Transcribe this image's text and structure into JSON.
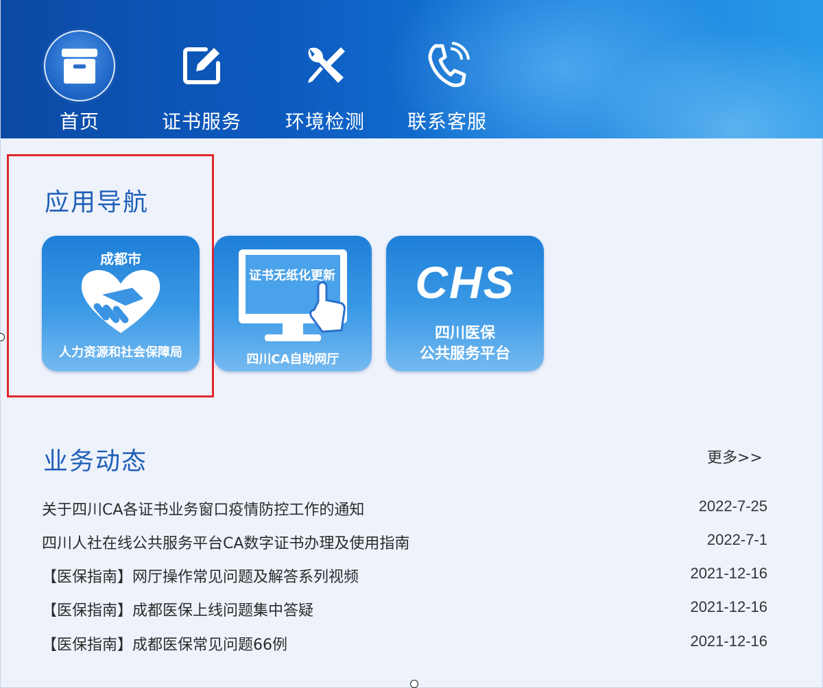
{
  "nav": {
    "items": [
      {
        "label": "首页",
        "icon": "archive-box-icon",
        "active": true
      },
      {
        "label": "证书服务",
        "icon": "edit-note-icon",
        "active": false
      },
      {
        "label": "环境检测",
        "icon": "wrench-screwdriver-icon",
        "active": false
      },
      {
        "label": "联系客服",
        "icon": "phone-icon",
        "active": false
      }
    ]
  },
  "app_nav": {
    "title": "应用导航",
    "tiles": [
      {
        "top": "成都市",
        "bottom": "人力资源和社会保障局",
        "icon": "handshake-heart-icon"
      },
      {
        "screen": "证书无纸化更新",
        "bottom": "四川CA自助网厅",
        "icon": "monitor-pointer-icon"
      },
      {
        "logo": "CHS",
        "line1": "四川医保",
        "line2": "公共服务平台",
        "icon": "chs-logo-icon"
      }
    ]
  },
  "news": {
    "title": "业务动态",
    "more": "更多>>",
    "items": [
      {
        "title": "关于四川CA各证书业务窗口疫情防控工作的通知",
        "date": "2022-7-25"
      },
      {
        "title": "四川人社在线公共服务平台CA数字证书办理及使用指南",
        "date": "2022-7-1"
      },
      {
        "title": "【医保指南】网厅操作常见问题及解答系列视频",
        "date": "2021-12-16"
      },
      {
        "title": "【医保指南】成都医保上线问题集中答疑",
        "date": "2021-12-16"
      },
      {
        "title": "【医保指南】成都医保常见问题66例",
        "date": "2021-12-16"
      }
    ]
  },
  "colors": {
    "header_start": "#0b4aa4",
    "header_end": "#2a9ae8",
    "section_title": "#1f5fb8",
    "highlight": "#e0262b",
    "background": "#eef2fb"
  }
}
